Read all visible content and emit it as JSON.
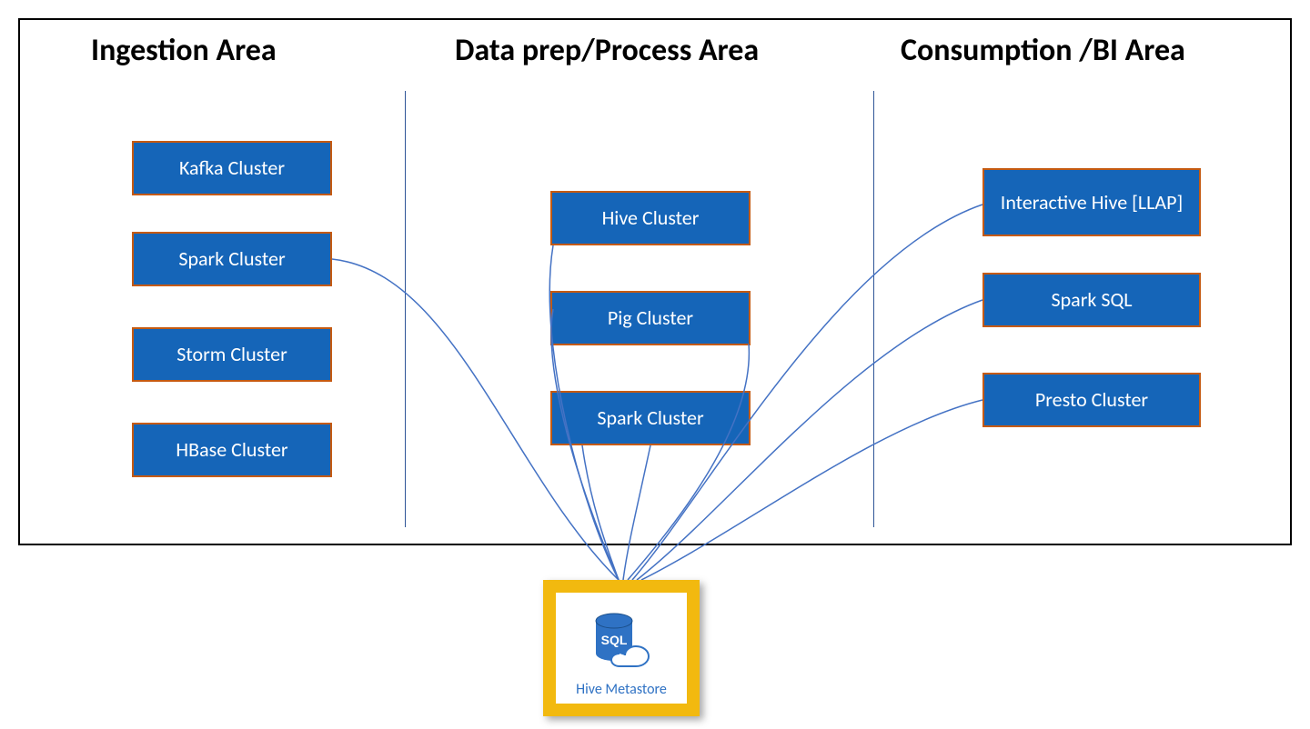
{
  "areas": {
    "ingestion": {
      "title": "Ingestion Area"
    },
    "process": {
      "title": "Data prep/Process Area"
    },
    "consume": {
      "title": "Consumption /BI Area"
    }
  },
  "nodes": {
    "ingestion": {
      "kafka": "Kafka Cluster",
      "spark": "Spark Cluster",
      "storm": "Storm Cluster",
      "hbase": "HBase Cluster"
    },
    "process": {
      "hive": "Hive Cluster",
      "pig": "Pig Cluster",
      "spark": "Spark Cluster"
    },
    "consume": {
      "llap": "Interactive Hive [LLAP]",
      "ssql": "Spark SQL",
      "presto": "Presto Cluster"
    }
  },
  "metastore": {
    "label": "Hive Metastore",
    "icon_text": "SQL"
  },
  "colors": {
    "node_fill": "#1565b8",
    "node_border": "#c55a11",
    "connector": "#4472c4",
    "metastore_border": "#f2b90f"
  }
}
